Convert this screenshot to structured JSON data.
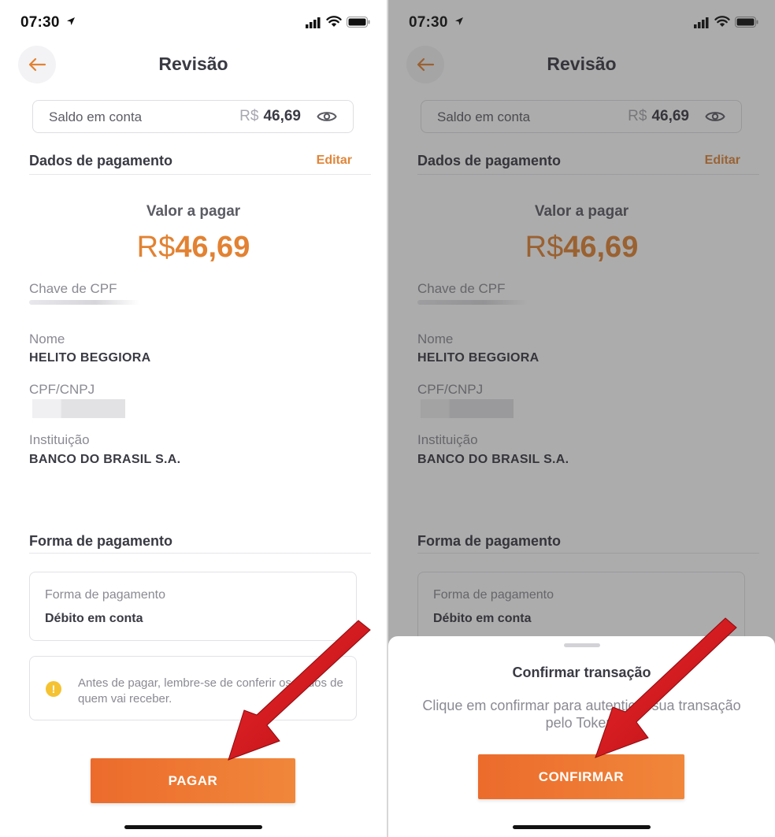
{
  "status_bar": {
    "time": "07:30"
  },
  "header": {
    "title": "Revisão"
  },
  "balance": {
    "label": "Saldo em conta",
    "currency": "R$",
    "value": "46,69"
  },
  "payment_data": {
    "title": "Dados de pagamento",
    "edit": "Editar",
    "amount_label": "Valor a pagar",
    "amount_currency": "R$",
    "amount_value": "46,69"
  },
  "fields": {
    "key_label": "Chave de CPF",
    "name_label": "Nome",
    "name_value": "HELITO BEGGIORA",
    "doc_label": "CPF/CNPJ",
    "institution_label": "Instituição",
    "institution_value": "BANCO DO BRASIL S.A."
  },
  "payment_method": {
    "title": "Forma de pagamento",
    "card_label": "Forma de pagamento",
    "card_value": "Débito em conta"
  },
  "warning": {
    "text": "Antes de pagar, lembre-se de conferir os dados de quem vai receber."
  },
  "pay_button": "PAGAR",
  "confirm_sheet": {
    "title": "Confirmar transação",
    "text": "Clique em confirmar para autenticar sua transação pelo Token.",
    "button": "CONFIRMAR"
  },
  "colors": {
    "accent": "#e28232",
    "button": "#ee7a33",
    "arrow": "#d9141b",
    "warning": "#f5c232"
  }
}
